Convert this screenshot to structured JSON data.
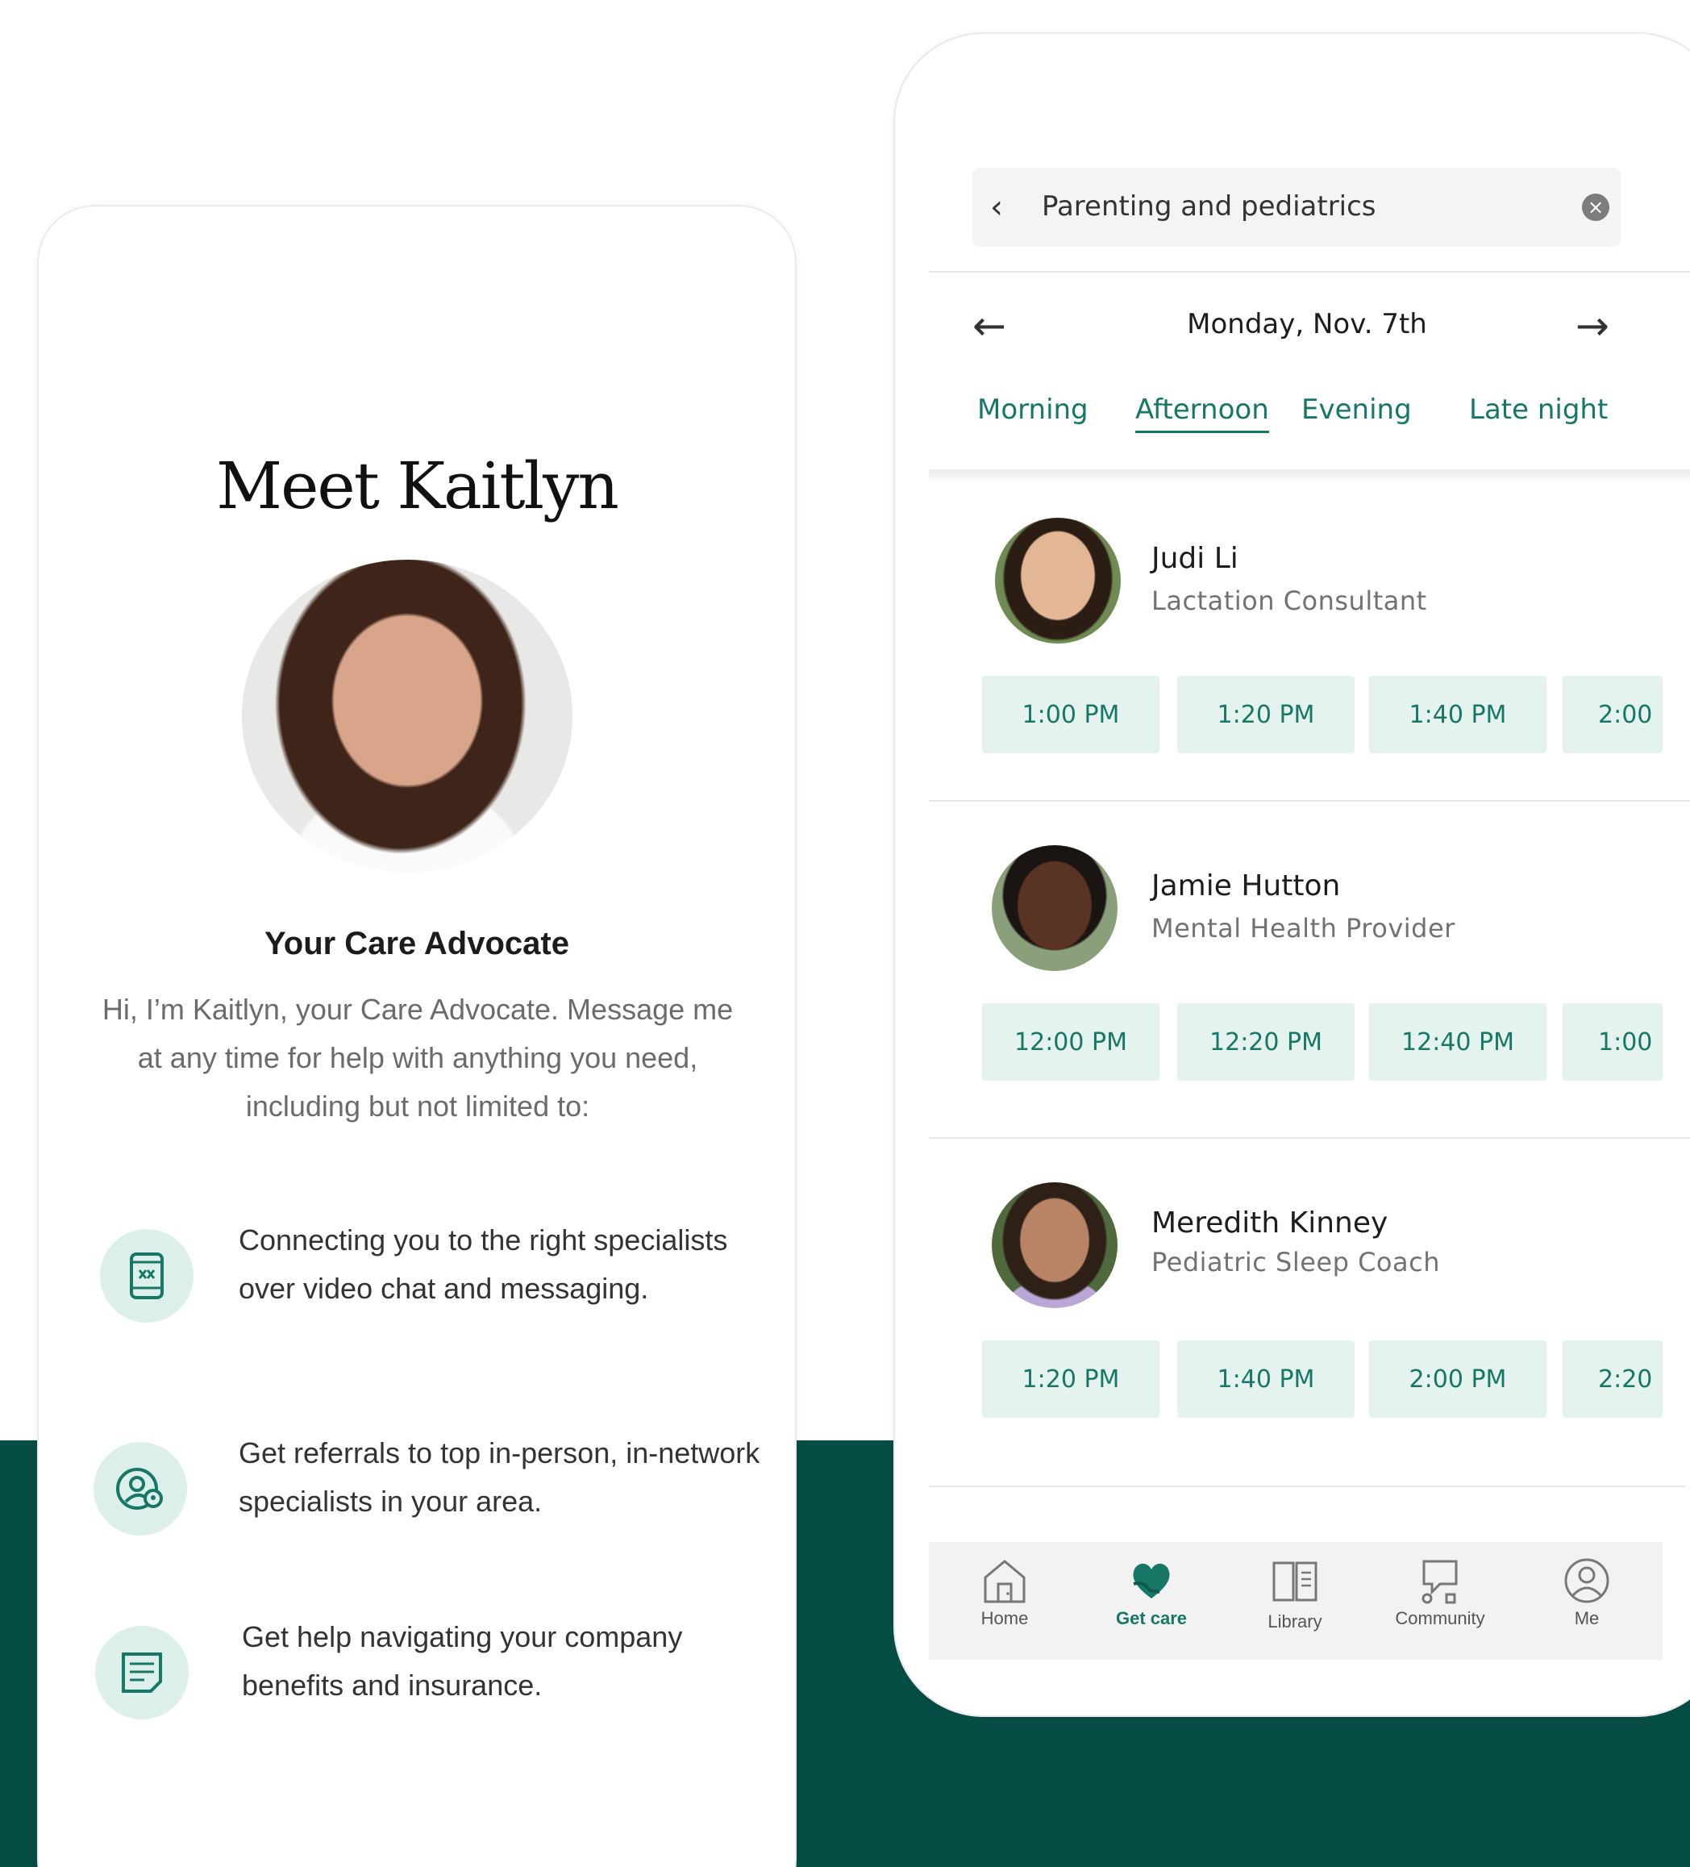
{
  "left_card": {
    "title": "Meet Kaitlyn",
    "role": "Your Care Advocate",
    "intro": "Hi, I’m Kaitlyn, your Care Advocate. Message me at any time for help with anything you need, including but not limited to:",
    "features": [
      {
        "icon": "phone-chat-icon",
        "text": "Connecting you to the right specialists over video chat and messaging."
      },
      {
        "icon": "person-location-icon",
        "text": "Get referrals to top in-person, in-network specialists in your area."
      },
      {
        "icon": "document-icon",
        "text": "Get help navigating your company benefits and insurance."
      }
    ]
  },
  "right_card": {
    "search": {
      "value": "Parenting and pediatrics",
      "back_icon": "chevron-left-icon",
      "clear_icon": "clear-icon"
    },
    "date": {
      "label": "Monday, Nov. 7th",
      "prev_icon": "arrow-left-icon",
      "next_icon": "arrow-right-icon"
    },
    "tabs": [
      {
        "label": "Morning",
        "active": false
      },
      {
        "label": "Afternoon",
        "active": true
      },
      {
        "label": "Evening",
        "active": false
      },
      {
        "label": "Late night",
        "active": false
      }
    ],
    "providers": [
      {
        "name": "Judi Li",
        "role": "Lactation Consultant",
        "slots": [
          "1:00 PM",
          "1:20 PM",
          "1:40 PM",
          "2:00"
        ]
      },
      {
        "name": "Jamie Hutton",
        "role": "Mental Health Provider",
        "slots": [
          "12:00 PM",
          "12:20 PM",
          "12:40 PM",
          "1:00"
        ]
      },
      {
        "name": "Meredith Kinney",
        "role": "Pediatric Sleep Coach",
        "slots": [
          "1:20 PM",
          "1:40 PM",
          "2:00 PM",
          "2:20"
        ]
      }
    ],
    "nav": [
      {
        "label": "Home",
        "icon": "home-icon",
        "active": false
      },
      {
        "label": "Get care",
        "icon": "heart-hand-icon",
        "active": true
      },
      {
        "label": "Library",
        "icon": "book-icon",
        "active": false
      },
      {
        "label": "Community",
        "icon": "chat-bubble-icon",
        "active": false
      },
      {
        "label": "Me",
        "icon": "user-icon",
        "active": false
      }
    ],
    "colors": {
      "accent": "#177766",
      "slot_bg": "#e5f3ef",
      "band": "#064d45"
    }
  }
}
